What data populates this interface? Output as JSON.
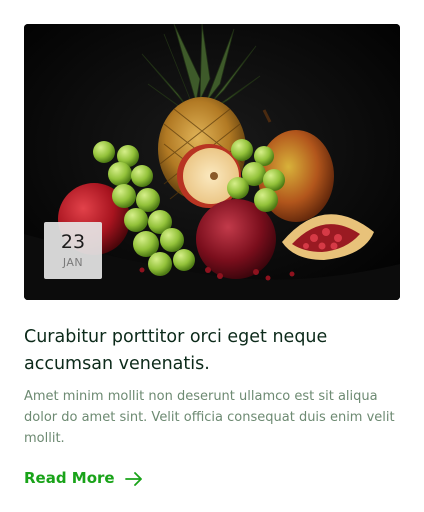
{
  "post": {
    "image_alt": "Pineapple, grapes, apples, pomegranates and pear on a dark background",
    "date": {
      "day": "23",
      "month": "JAN"
    },
    "title": "Curabitur porttitor orci eget neque accumsan venenatis.",
    "excerpt": "Amet minim mollit non deserunt ullamco est sit aliqua dolor do amet sint. Velit officia consequat duis enim velit mollit.",
    "read_more_label": "Read More",
    "read_more_icon": "arrow-right-icon"
  },
  "colors": {
    "title": "#0c2a1a",
    "excerpt": "#6d8a72",
    "accent": "#19a319",
    "badge_bg": "#e6e6e6"
  }
}
